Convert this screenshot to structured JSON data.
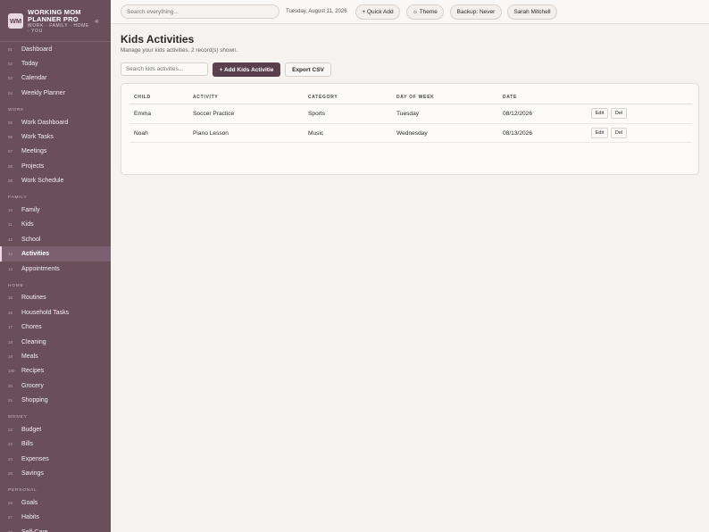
{
  "brand": {
    "logo": "WM",
    "title": "WORKING MOM PLANNER PRO",
    "subtitle": "WORK · FAMILY · HOME · YOU",
    "collapse_icon": "«"
  },
  "topbar": {
    "search_placeholder": "Search everything...",
    "date": "Tuesday, August 11, 2026",
    "quick_add": "+ Quick Add",
    "theme": "☼ Theme",
    "backup": "Backup: Never",
    "user": "Sarah Mitchell"
  },
  "sidebar": {
    "groups": [
      {
        "section": "",
        "items": [
          {
            "num": "01",
            "label": "Dashboard"
          },
          {
            "num": "02",
            "label": "Today"
          },
          {
            "num": "03",
            "label": "Calendar"
          },
          {
            "num": "04",
            "label": "Weekly Planner"
          }
        ]
      },
      {
        "section": "WORK",
        "items": [
          {
            "num": "05",
            "label": "Work Dashboard"
          },
          {
            "num": "06",
            "label": "Work Tasks"
          },
          {
            "num": "07",
            "label": "Meetings"
          },
          {
            "num": "08",
            "label": "Projects"
          },
          {
            "num": "09",
            "label": "Work Schedule"
          }
        ]
      },
      {
        "section": "FAMILY",
        "items": [
          {
            "num": "10",
            "label": "Family"
          },
          {
            "num": "11",
            "label": "Kids"
          },
          {
            "num": "12",
            "label": "School"
          },
          {
            "num": "13",
            "label": "Activities",
            "active": true
          },
          {
            "num": "14",
            "label": "Appointments"
          }
        ]
      },
      {
        "section": "HOME",
        "items": [
          {
            "num": "15",
            "label": "Routines"
          },
          {
            "num": "16",
            "label": "Household Tasks"
          },
          {
            "num": "17",
            "label": "Chores"
          },
          {
            "num": "18",
            "label": "Cleaning"
          },
          {
            "num": "19",
            "label": "Meals"
          },
          {
            "num": "19b",
            "label": "Recipes"
          },
          {
            "num": "20",
            "label": "Grocery"
          },
          {
            "num": "21",
            "label": "Shopping"
          }
        ]
      },
      {
        "section": "MONEY",
        "items": [
          {
            "num": "22",
            "label": "Budget"
          },
          {
            "num": "23",
            "label": "Bills"
          },
          {
            "num": "24",
            "label": "Expenses"
          },
          {
            "num": "25",
            "label": "Savings"
          }
        ]
      },
      {
        "section": "PERSONAL",
        "items": [
          {
            "num": "26",
            "label": "Goals"
          },
          {
            "num": "27",
            "label": "Habits"
          },
          {
            "num": "28",
            "label": "Self-Care"
          }
        ]
      }
    ]
  },
  "main": {
    "title": "Kids Activities",
    "subtitle": "Manage your kids activities. 2 record(s) shown.",
    "search_placeholder": "Search kids activities...",
    "add_button": "+ Add Kids Activitie",
    "export_button": "Export CSV",
    "table": {
      "headers": [
        "CHILD",
        "ACTIVITY",
        "CATEGORY",
        "DAY OF WEEK",
        "DATE"
      ],
      "rows": [
        {
          "child": "Emma",
          "activity": "Soccer Practice",
          "category": "Sports",
          "day": "Tuesday",
          "date": "08/12/2026"
        },
        {
          "child": "Noah",
          "activity": "Piano Lesson",
          "category": "Music",
          "day": "Wednesday",
          "date": "08/13/2026"
        }
      ],
      "edit_label": "Edit",
      "delete_label": "Del"
    }
  },
  "colors": {
    "sidebar": "#6a4f5b",
    "primary": "#5a3f4c",
    "background": "#f5f2ef"
  }
}
